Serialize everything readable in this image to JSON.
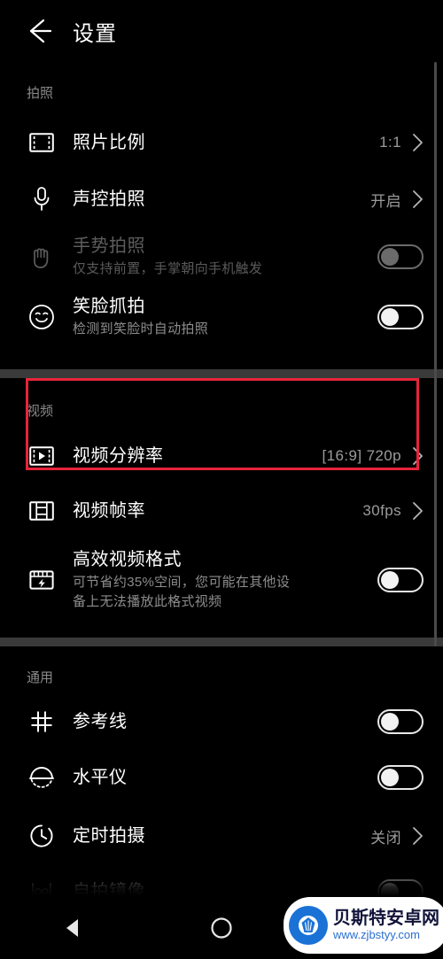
{
  "header": {
    "title": "设置",
    "back_icon": "arrow-left-icon"
  },
  "sections": [
    {
      "label": "拍照",
      "rows": [
        {
          "icon": "photo-ratio-icon",
          "title": "照片比例",
          "value": "1:1",
          "control": "chevron"
        },
        {
          "icon": "microphone-icon",
          "title": "声控拍照",
          "value": "开启",
          "control": "chevron"
        },
        {
          "icon": "hand-icon",
          "title": "手势拍照",
          "subtitle": "仅支持前置，手掌朝向手机触发",
          "control": "toggle",
          "toggle_on": false,
          "disabled": true
        },
        {
          "icon": "smiley-icon",
          "title": "笑脸抓拍",
          "subtitle": "检测到笑脸时自动拍照",
          "control": "toggle",
          "toggle_on": false,
          "disabled": false
        }
      ]
    },
    {
      "label": "视频",
      "rows": [
        {
          "icon": "video-resolution-icon",
          "title": "视频分辨率",
          "value": "[16:9] 720p",
          "control": "chevron"
        },
        {
          "icon": "film-strip-icon",
          "title": "视频帧率",
          "value": "30fps",
          "control": "chevron"
        },
        {
          "icon": "video-bolt-icon",
          "title": "高效视频格式",
          "subtitle": "可节省约35%空间，您可能在其他设",
          "subtitle2": "备上无法播放此格式视频",
          "control": "toggle",
          "toggle_on": false,
          "disabled": false
        }
      ]
    },
    {
      "label": "通用",
      "rows": [
        {
          "icon": "grid-lines-icon",
          "title": "参考线",
          "control": "toggle",
          "toggle_on": false,
          "disabled": false
        },
        {
          "icon": "level-icon",
          "title": "水平仪",
          "control": "toggle",
          "toggle_on": false,
          "disabled": false
        },
        {
          "icon": "timer-icon",
          "title": "定时拍摄",
          "value": "关闭",
          "control": "chevron"
        },
        {
          "icon": "mirror-icon",
          "title": "自拍镜像",
          "control": "toggle",
          "toggle_on": false,
          "disabled": false
        }
      ]
    }
  ],
  "annotation": {
    "color": "#e8243c",
    "target": "视频分辨率"
  },
  "navbar": {
    "back_label": "back-triangle",
    "home_label": "home-circle",
    "recents_label": "recents-square"
  },
  "watermark": {
    "title": "贝斯特安卓网",
    "url": "www.zjbstyy.com"
  }
}
